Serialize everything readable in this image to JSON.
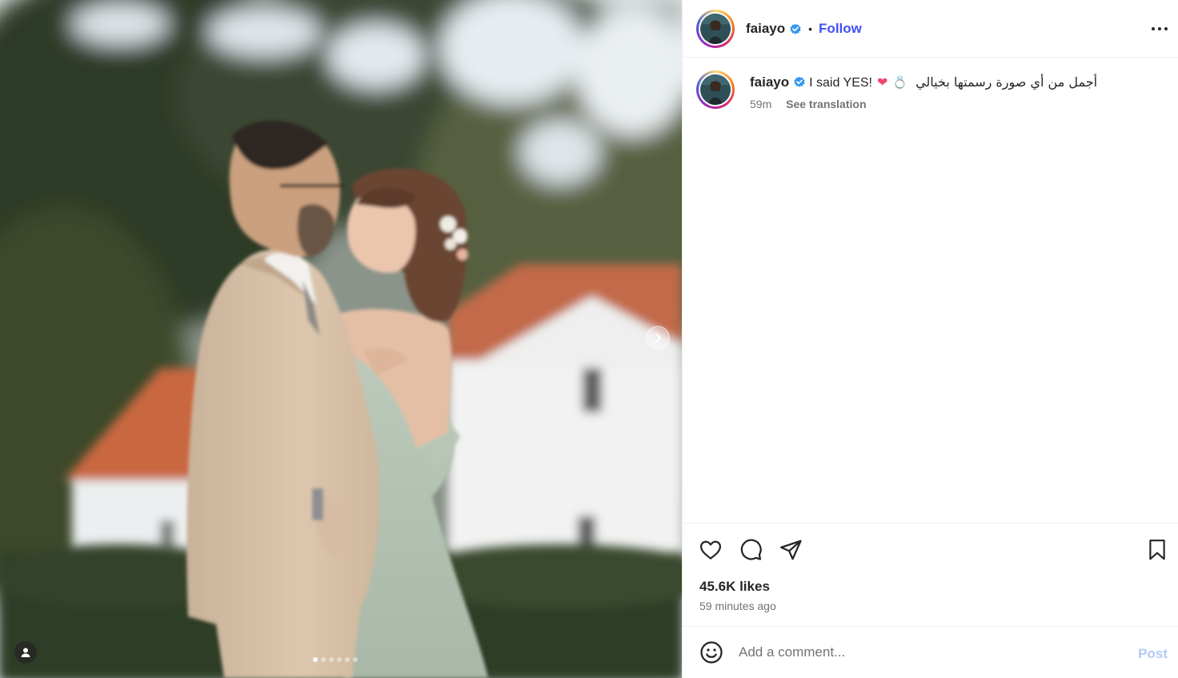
{
  "media": {
    "slide_count": 6,
    "active_slide": 1,
    "icons": {
      "next": "chevron-right-icon",
      "tags": "user-tag-icon"
    }
  },
  "header": {
    "username": "faiayo",
    "separator": "•",
    "follow_label": "Follow",
    "icons": {
      "verified": "verified-badge-icon",
      "more": "more-options-icon"
    }
  },
  "caption": {
    "username": "faiayo",
    "text": "I said YES!",
    "emojis": [
      "❤",
      "💍"
    ],
    "arabic_text": "أجمل من أي صورة رسمتها بخيالي",
    "time": "59m",
    "translation_label": "See translation"
  },
  "actions": {
    "likes": "45.6K likes",
    "time_ago": "59 minutes ago",
    "icons": [
      "heart-icon",
      "comment-icon",
      "share-icon",
      "bookmark-icon"
    ]
  },
  "comment": {
    "placeholder": "Add a comment...",
    "post_label": "Post",
    "icons": {
      "emoji": "emoji-icon"
    }
  },
  "colors": {
    "follow": "#4150f7",
    "post_disabled": "#b3c9f5",
    "verified": "#3897f0",
    "muted_text": "#737373"
  }
}
